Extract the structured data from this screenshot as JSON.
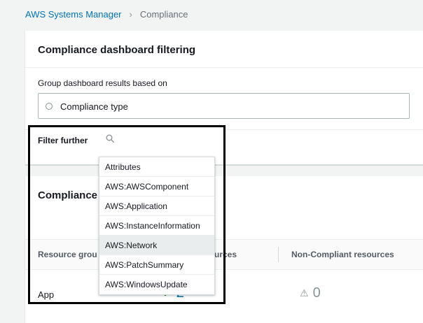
{
  "breadcrumb": {
    "parent": "AWS Systems Manager",
    "separator": ">",
    "current": "Compliance"
  },
  "filtering": {
    "title": "Compliance dashboard filtering",
    "group_label": "Group dashboard results based on",
    "radio_label": "Compliance type",
    "filter_label": "Filter further",
    "search_placeholder": ""
  },
  "dropdown": {
    "items": [
      "Attributes",
      "AWS:AWSComponent",
      "AWS:Application",
      "AWS:InstanceInformation",
      "AWS:Network",
      "AWS:PatchSummary",
      "AWS:WindowsUpdate"
    ],
    "highlighted_index": 4
  },
  "summary": {
    "title": "Compliance resources summary",
    "title_visible": "Compliance",
    "columns": [
      "Resource group",
      "Compliant resources",
      "Non-Compliant resources"
    ],
    "columns_visible": [
      "Resource grou",
      "urces",
      "Non-Compliant resources"
    ],
    "rows": [
      {
        "group": "App",
        "compliant": "2",
        "noncompliant": "0"
      }
    ]
  },
  "icons": {
    "warning": "⚠",
    "check": "✓"
  },
  "colors": {
    "link": "#0073bb",
    "highlight_border": "#000000",
    "success": "#1d8102"
  }
}
